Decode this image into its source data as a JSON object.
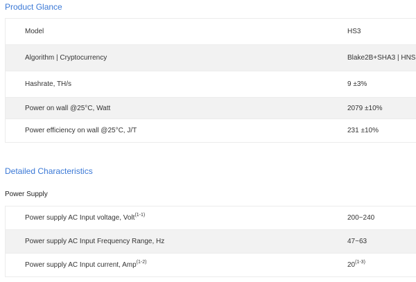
{
  "product_glance": {
    "title": "Product Glance",
    "rows": [
      {
        "label": "Model",
        "value": "HS3"
      },
      {
        "label": "Algorithm | Cryptocurrency",
        "value": "Blake2B+SHA3 | HNS"
      },
      {
        "label": "Hashrate, TH/s",
        "value": "9 ±3%"
      },
      {
        "label": "Power on wall @25°C, Watt",
        "value": "2079 ±10%"
      },
      {
        "label": "Power efficiency on wall @25°C, J/T",
        "value": "231 ±10%"
      }
    ]
  },
  "detailed": {
    "title": "Detailed Characteristics",
    "subsection": "Power Supply",
    "rows": [
      {
        "label": "Power supply AC Input voltage, Volt",
        "label_sup": "(1-1)",
        "value": "200~240",
        "value_sup": ""
      },
      {
        "label": "Power supply AC Input Frequency Range, Hz",
        "label_sup": "",
        "value": "47~63",
        "value_sup": ""
      },
      {
        "label": "Power supply AC Input current, Amp",
        "label_sup": "(1-2)",
        "value": "20",
        "value_sup": "(1-3)"
      }
    ]
  }
}
